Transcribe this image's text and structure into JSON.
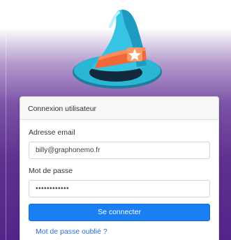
{
  "logo": {
    "icon": "wizard-hat-icon"
  },
  "login_card": {
    "title": "Connexion utilisateur",
    "email_label": "Adresse email",
    "email_value": "billy@graphonemo.fr",
    "password_label": "Mot de passe",
    "password_value": "••••••••••••",
    "submit_label": "Se connecter",
    "forgot_link": "Mot de passe oublié ?"
  },
  "colors": {
    "primary_button": "#1a7ff3",
    "link": "#2a70d4",
    "background_top": "#ffffff",
    "background_bottom": "#53258a"
  }
}
